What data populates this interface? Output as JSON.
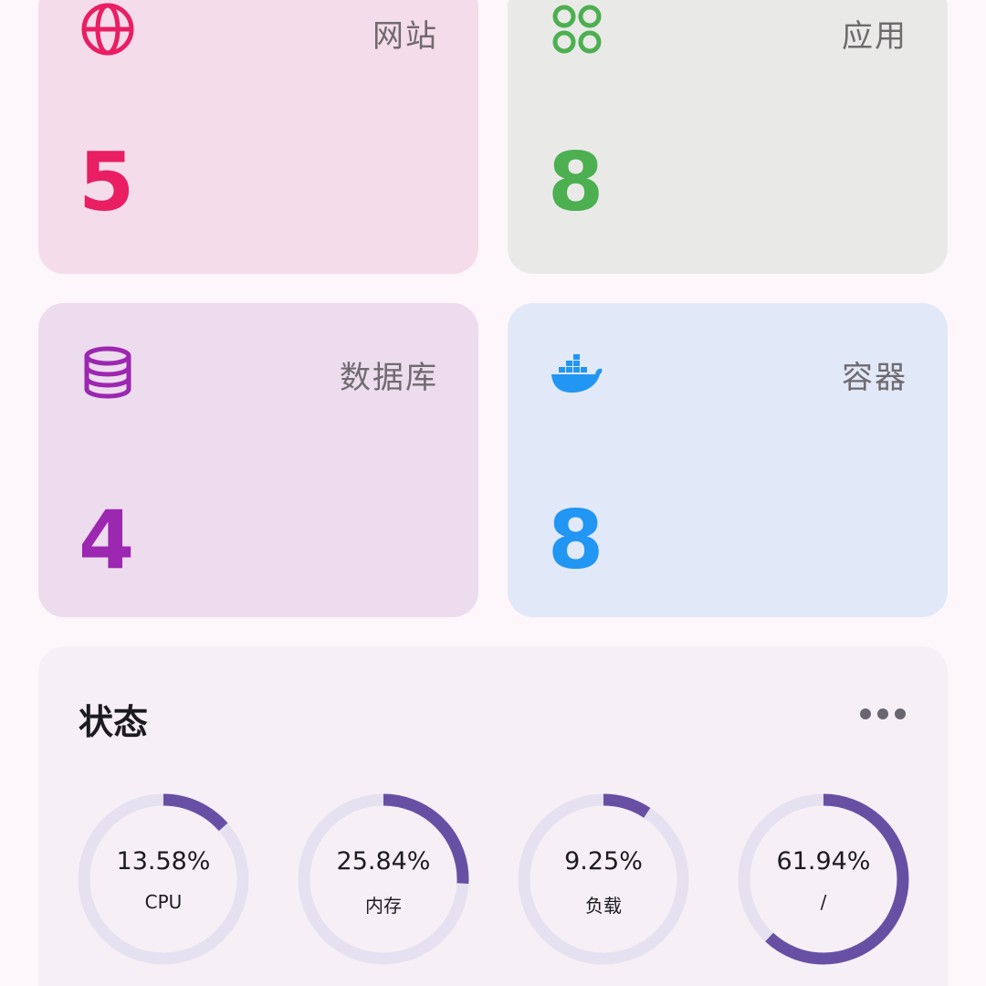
{
  "cards": {
    "websites": {
      "label": "网站",
      "count": "5",
      "icon": "globe-icon",
      "color": "#e91e63",
      "bg": "#f5dcea"
    },
    "apps": {
      "label": "应用",
      "count": "8",
      "icon": "apps-grid-icon",
      "color": "#4caf50",
      "bg": "#e9eae8"
    },
    "databases": {
      "label": "数据库",
      "count": "4",
      "icon": "database-icon",
      "color": "#9c27b0",
      "bg": "#eddcee"
    },
    "containers": {
      "label": "容器",
      "count": "8",
      "icon": "docker-icon",
      "color": "#2196f3",
      "bg": "#e1e8f7"
    }
  },
  "status": {
    "title": "状态",
    "more_icon": "more-horizontal-icon",
    "track_color": "#e6e1f0",
    "progress_color": "#6750a4",
    "gauges": [
      {
        "id": "cpu",
        "value": "13.58%",
        "percent": 13.58,
        "label": "CPU",
        "sub": ""
      },
      {
        "id": "mem",
        "value": "25.84%",
        "percent": 25.84,
        "label": "内存",
        "sub": ""
      },
      {
        "id": "load",
        "value": "9.25%",
        "percent": 9.25,
        "label": "负载",
        "sub": ""
      },
      {
        "id": "disk",
        "value": "61.94%",
        "percent": 61.94,
        "label": "/",
        "sub": ""
      }
    ]
  }
}
